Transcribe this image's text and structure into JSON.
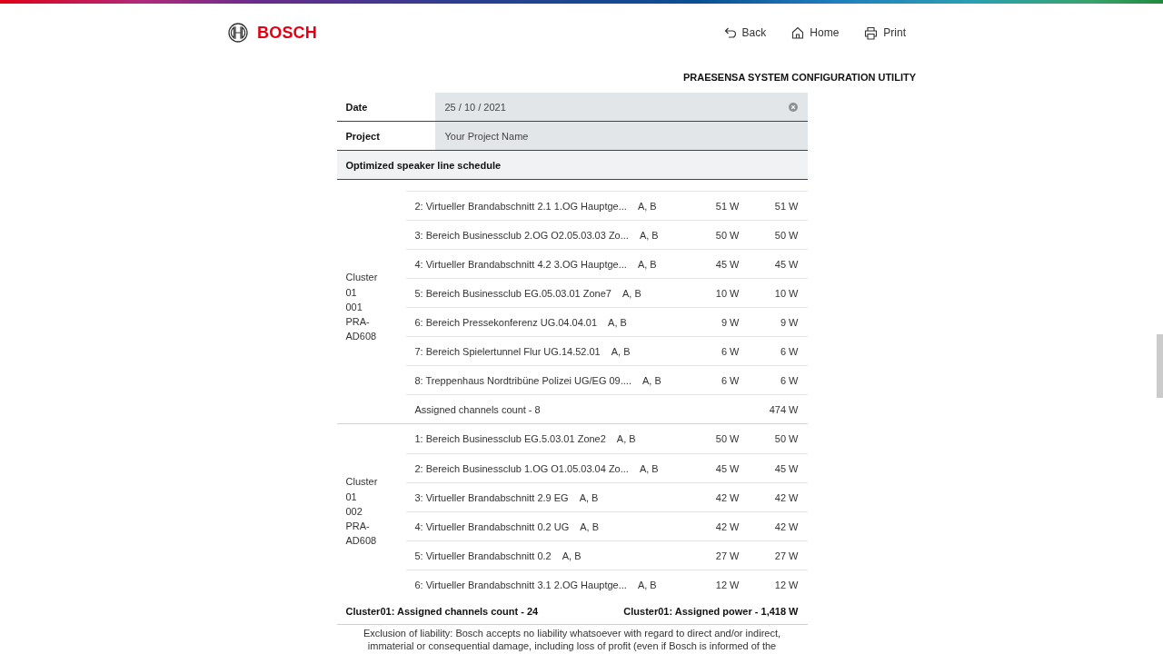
{
  "header": {
    "logo": {
      "text": "BOSCH"
    },
    "nav": [
      {
        "kind": "back",
        "label": "Back"
      },
      {
        "kind": "home",
        "label": "Home"
      },
      {
        "kind": "print",
        "label": "Print"
      }
    ]
  },
  "title": "PRAESENSA SYSTEM CONFIGURATION UTILITY",
  "form": {
    "fields": [
      {
        "label": "Date",
        "value": "25 / 10 / 2021",
        "clearable": true
      },
      {
        "label": "Project",
        "value": "Your Project Name",
        "clearable": false
      }
    ]
  },
  "schedule": {
    "title": "Optimized speaker line schedule",
    "clusters": [
      {
        "label": "Cluster 01 001 PRA-AD608",
        "rows": [
          {
            "column_1": "2: Virtueller Brandabschnitt 2.1 1.OG Hauptge...",
            "column_2": "A, B",
            "column_3": "51 W",
            "column_4": "51 W"
          },
          {
            "column_1": "3: Bereich Businessclub 2.OG O2.05.03.03 Zo...",
            "column_2": "A, B",
            "column_3": "50 W",
            "column_4": "50 W"
          },
          {
            "column_1": "4: Virtueller Brandabschnitt 4.2 3.OG Hauptge...",
            "column_2": "A, B",
            "column_3": "45 W",
            "column_4": "45 W"
          },
          {
            "column_1": "5: Bereich Businessclub EG.05.03.01 Zone7",
            "column_2": "A, B",
            "column_3": "10 W",
            "column_4": "10 W"
          },
          {
            "column_1": "6: Bereich Pressekonferenz UG.04.04.01",
            "column_2": "A, B",
            "column_3": "9 W",
            "column_4": "9 W"
          },
          {
            "column_1": "7: Bereich Spielertunnel Flur UG.14.52.01",
            "column_2": "A, B",
            "column_3": "6 W",
            "column_4": "6 W"
          },
          {
            "column_1": "8: Treppenhaus Nordtribüne Polizei UG/EG 09....",
            "column_2": "A, B",
            "column_3": "6 W",
            "column_4": "6 W"
          }
        ],
        "count": {
          "label": "Assigned channels count - 8",
          "total": "474 W"
        }
      },
      {
        "label": "Cluster 01 002 PRA-AD608",
        "rows": [
          {
            "column_1": "1: Bereich Businessclub EG.5.03.01 Zone2",
            "column_2": "A, B",
            "column_3": "50 W",
            "column_4": "50 W"
          },
          {
            "column_1": "2: Bereich Businessclub 1.OG O1.05.03.04 Zo...",
            "column_2": "A, B",
            "column_3": "45 W",
            "column_4": "45 W"
          },
          {
            "column_1": "3: Virtueller Brandabschnitt 2.9 EG",
            "column_2": "A, B",
            "column_3": "42 W",
            "column_4": "42 W"
          },
          {
            "column_1": "4: Virtueller Brandabschnitt 0.2 UG",
            "column_2": "A, B",
            "column_3": "42 W",
            "column_4": "42 W"
          },
          {
            "column_1": "5: Virtueller Brandabschnitt 0.2",
            "column_2": "A, B",
            "column_3": "27 W",
            "column_4": "27 W"
          },
          {
            "column_1": "6: Virtueller Brandabschnitt 3.1 2.OG Hauptge...",
            "column_2": "A, B",
            "column_3": "12 W",
            "column_4": "12 W"
          }
        ]
      }
    ],
    "summary": {
      "count": "Cluster01: Assigned channels count - 24",
      "power": "Cluster01: Assigned power - 1,418 W"
    }
  },
  "disclaimer": "Exclusion of liability: Bosch accepts no liability whatsoever with regard to direct and/or indirect, immaterial or consequential damage, including loss of profit (even if Bosch is informed of the"
}
